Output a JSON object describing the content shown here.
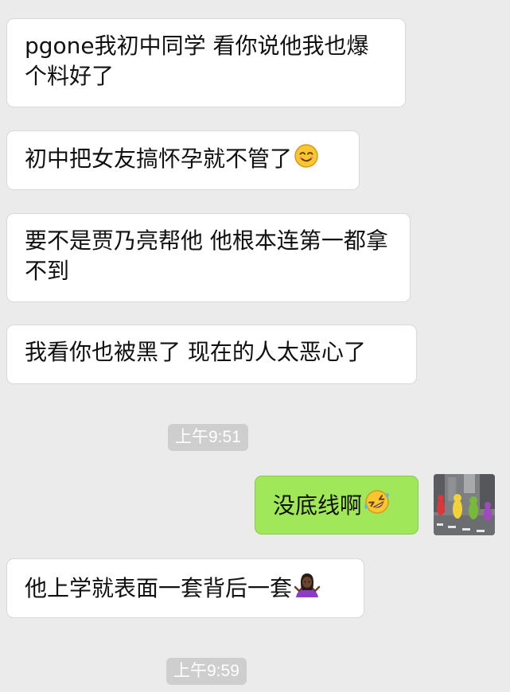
{
  "messages": [
    {
      "side": "incoming",
      "text": "pgone我初中同学 看你说他我也爆个料好了"
    },
    {
      "side": "incoming",
      "text": "初中把女友搞怀孕就不管了",
      "emoji": "smiling-face-icon"
    },
    {
      "side": "incoming",
      "text": "要不是贾乃亮帮他 他根本连第一都拿不到"
    },
    {
      "side": "incoming",
      "text": "我看你也被黑了 现在的人太恶心了"
    },
    {
      "side": "outgoing",
      "text": "没底线啊",
      "emoji": "rolling-on-floor-laughing-icon"
    },
    {
      "side": "incoming",
      "text": "他上学就表面一套背后一套",
      "emoji": "person-shrugging-icon"
    }
  ],
  "timestamps": [
    "上午9:51",
    "上午9:59"
  ],
  "colors": {
    "background": "#ebebeb",
    "incoming_bubble": "#ffffff",
    "outgoing_bubble": "#a0e75a",
    "timestamp_pill": "#cecece"
  }
}
